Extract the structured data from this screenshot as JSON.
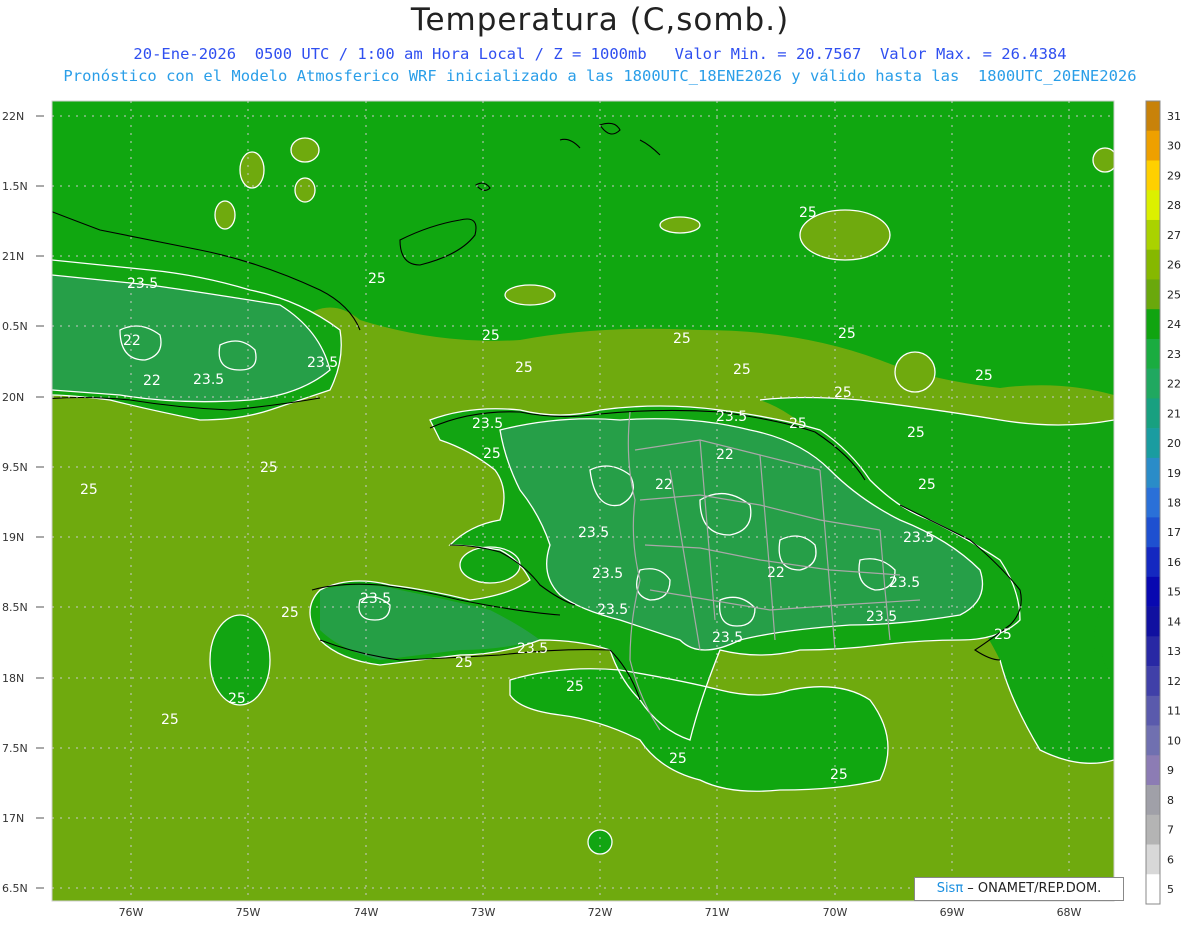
{
  "header": {
    "title": "Temperatura (C,somb.)",
    "line1": "20-Ene-2026  0500 UTC / 1:00 am Hora Local / Z = 1000mb   Valor Min. = 20.7567  Valor Max. = 26.4384",
    "line2": "Pronóstico con el Modelo Atmosferico WRF inicializado a las 1800UTC_18ENE2026 y válido hasta las  1800UTC_20ENE2026"
  },
  "axes": {
    "lat_labels": [
      "22N",
      "1.5N",
      "21N",
      "0.5N",
      "20N",
      "9.5N",
      "19N",
      "8.5N",
      "18N",
      "7.5N",
      "17N",
      "6.5N"
    ],
    "lon_labels": [
      "76W",
      "75W",
      "74W",
      "73W",
      "72W",
      "71W",
      "70W",
      "69W",
      "68W"
    ]
  },
  "contour_labels": [
    "25",
    "23.5",
    "22"
  ],
  "colorbar": {
    "ticks": [
      "5",
      "6",
      "7",
      "8",
      "9",
      "10",
      "11",
      "12",
      "13",
      "14",
      "15",
      "16",
      "17",
      "18",
      "19",
      "20",
      "21",
      "22",
      "23",
      "24",
      "25",
      "26",
      "27",
      "28",
      "29",
      "30",
      "31"
    ],
    "colors": [
      "#ffffff",
      "#d8d8d8",
      "#b4b4b4",
      "#a0a0a8",
      "#8c7cb4",
      "#7070b0",
      "#5a5aac",
      "#4040a8",
      "#2828a4",
      "#1010a0",
      "#0808b0",
      "#1428c0",
      "#1e50d0",
      "#2a70d8",
      "#2a8cc8",
      "#1a9ca0",
      "#18a080",
      "#20a860",
      "#1aac40",
      "#10a410",
      "#6aa80c",
      "#86b800",
      "#aad200",
      "#dcf000",
      "#ffd000",
      "#eea000",
      "#c8820a"
    ]
  },
  "map_fields": {
    "sea_color": "#6faa0e",
    "warm_land_color": "#12a512",
    "cool_land_color": "#2a9e52",
    "contour_color": "#ffffff",
    "coast_color": "#000000",
    "border_color": "#a0a0a0"
  },
  "credit": {
    "sis": "Sisπ",
    "rest": " – ONAMET/REP.DOM."
  }
}
